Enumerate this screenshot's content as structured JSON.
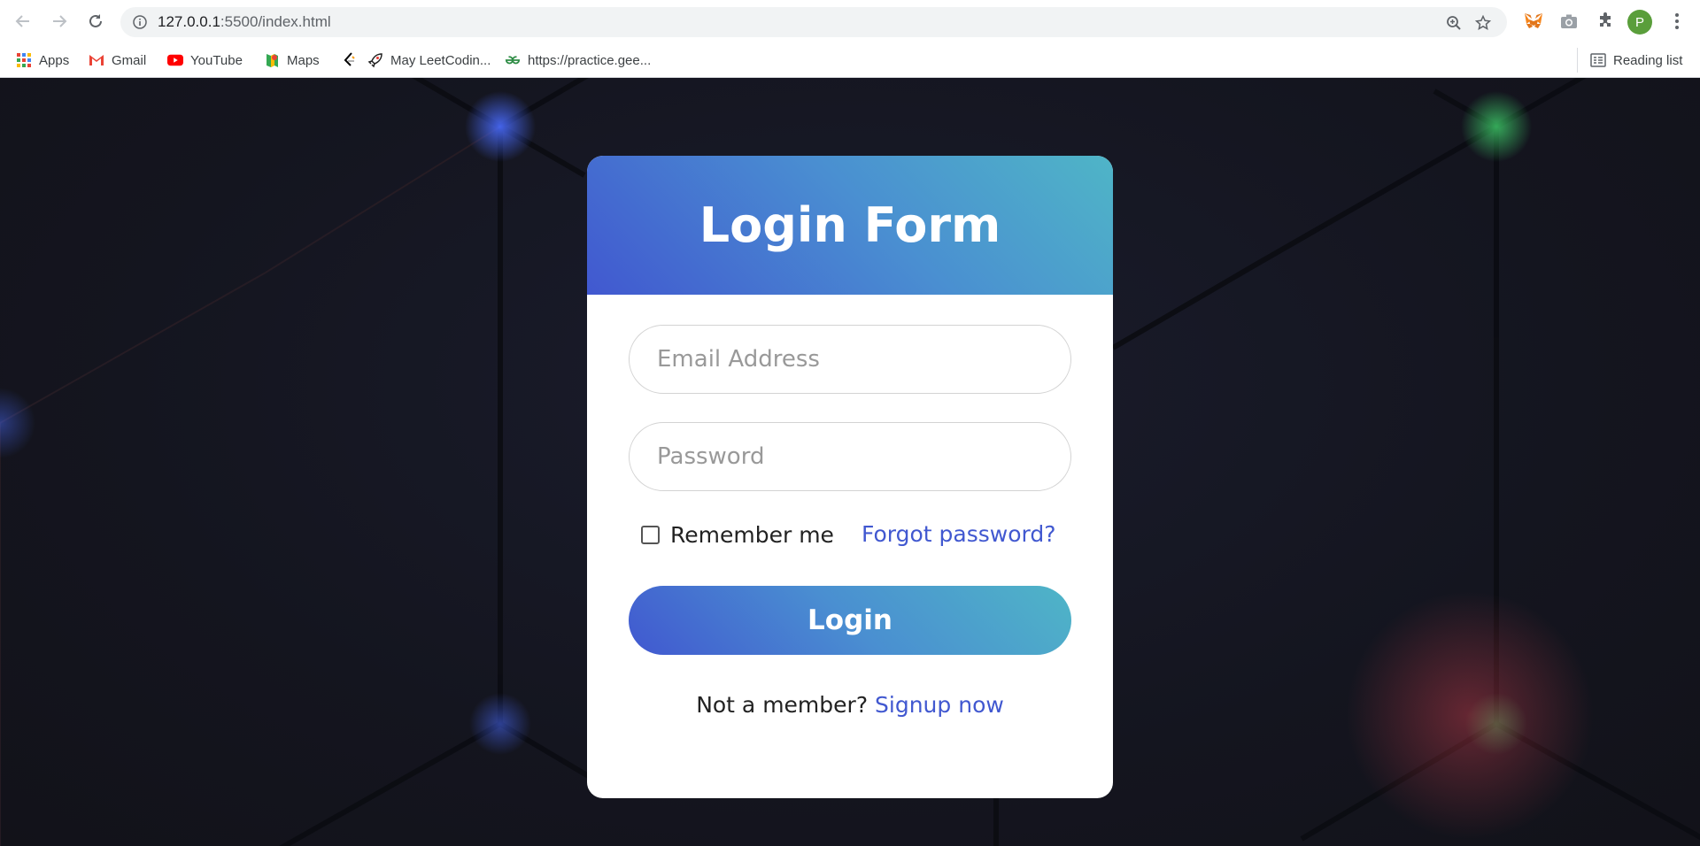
{
  "browser": {
    "url_host": "127.0.0.1",
    "url_path": ":5500/index.html",
    "avatar_letter": "P",
    "bookmarks": [
      {
        "label": "Apps",
        "icon": "apps-grid-icon"
      },
      {
        "label": "Gmail",
        "icon": "gmail-icon"
      },
      {
        "label": "YouTube",
        "icon": "youtube-icon"
      },
      {
        "label": "Maps",
        "icon": "maps-icon"
      },
      {
        "label": "",
        "icon": "leetcode-icon"
      },
      {
        "label": "May LeetCodin...",
        "icon": "rocket-icon"
      },
      {
        "label": "https://practice.gee...",
        "icon": "geeksforgeeks-icon"
      }
    ],
    "reading_list": "Reading list"
  },
  "form": {
    "title": "Login Form",
    "email_placeholder": "Email Address",
    "password_placeholder": "Password",
    "remember_label": "Remember me",
    "forgot_label": "Forgot password?",
    "login_label": "Login",
    "signup_prompt": "Not a member?",
    "signup_link": "Signup now"
  },
  "colors": {
    "accent": "#4158d0",
    "gradient_end": "#4fb5c7",
    "page_background": "#14151f"
  }
}
